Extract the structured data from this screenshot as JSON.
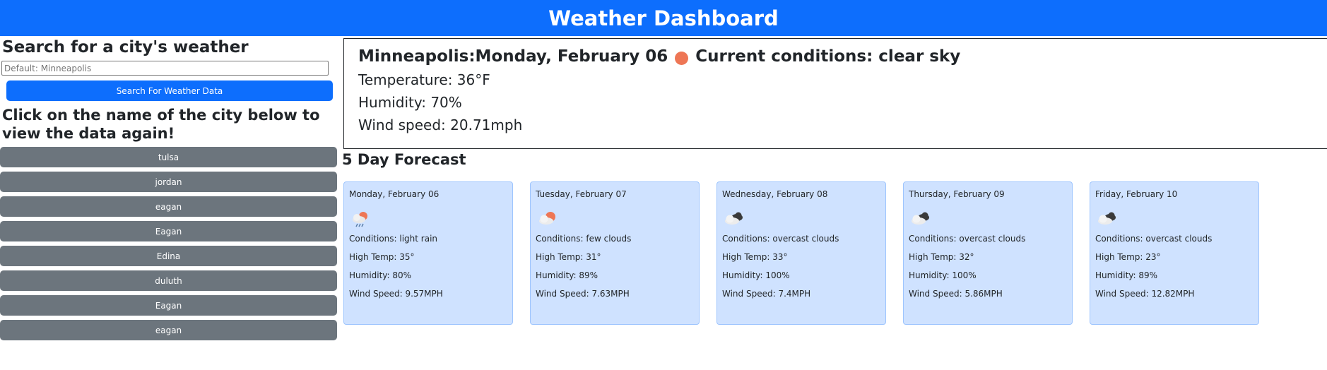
{
  "header": {
    "title": "Weather Dashboard"
  },
  "search": {
    "title": "Search for a city's weather",
    "placeholder": "Default: Minneapolis",
    "button_label": "Search For Weather Data"
  },
  "history": {
    "title": "Click on the name of the city below to view the data again!",
    "cities": [
      "tulsa",
      "jordan",
      "eagan",
      "Eagan",
      "Edina",
      "duluth",
      "Eagan",
      "eagan"
    ]
  },
  "current": {
    "city_date": "Minneapolis:Monday, February 06",
    "conditions": "Current conditions: clear sky",
    "temperature": "Temperature: 36°F",
    "humidity": "Humidity: 70%",
    "wind": "Wind speed: 20.71mph",
    "dot_color": "#ee7655"
  },
  "forecast": {
    "title": "5 Day Forecast",
    "days": [
      {
        "date": "Monday, February 06",
        "icon": "rain-cloud-icon",
        "conditions": "Conditions: light rain",
        "high": "High Temp: 35°",
        "humidity": "Humidity: 80%",
        "wind": "Wind Speed: 9.57MPH"
      },
      {
        "date": "Tuesday, February 07",
        "icon": "few-clouds-icon",
        "conditions": "Conditions: few clouds",
        "high": "High Temp: 31°",
        "humidity": "Humidity: 89%",
        "wind": "Wind Speed: 7.63MPH"
      },
      {
        "date": "Wednesday, February 08",
        "icon": "overcast-clouds-icon",
        "conditions": "Conditions: overcast clouds",
        "high": "High Temp: 33°",
        "humidity": "Humidity: 100%",
        "wind": "Wind Speed: 7.4MPH"
      },
      {
        "date": "Thursday, February 09",
        "icon": "overcast-clouds-icon",
        "conditions": "Conditions: overcast clouds",
        "high": "High Temp: 32°",
        "humidity": "Humidity: 100%",
        "wind": "Wind Speed: 5.86MPH"
      },
      {
        "date": "Friday, February 10",
        "icon": "overcast-clouds-icon",
        "conditions": "Conditions: overcast clouds",
        "high": "High Temp: 23°",
        "humidity": "Humidity: 89%",
        "wind": "Wind Speed: 12.82MPH"
      }
    ]
  },
  "colors": {
    "primary": "#0d6efd",
    "secondary": "#6c757d",
    "card_bg": "#cfe2ff",
    "card_border": "#9ec5fe"
  }
}
